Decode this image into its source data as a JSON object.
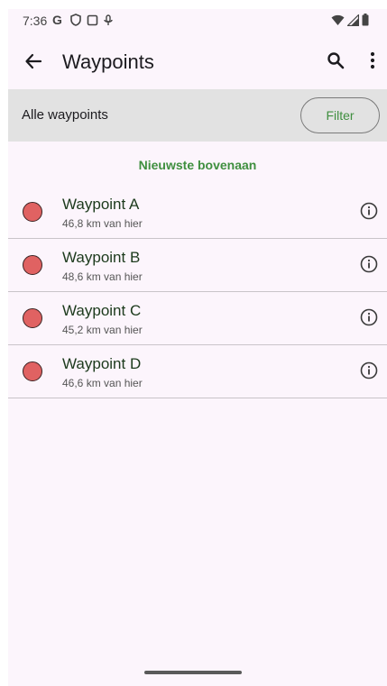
{
  "status_bar": {
    "time": "7:36",
    "icons_left": [
      "google-icon",
      "shield-icon",
      "screen-icon",
      "mic-icon"
    ],
    "icons_right": [
      "wifi-icon",
      "signal-icon",
      "battery-icon"
    ]
  },
  "app_bar": {
    "title": "Waypoints",
    "back_icon": "arrow-back-icon",
    "search_icon": "search-icon",
    "more_icon": "more-vert-icon"
  },
  "filter_bar": {
    "label": "Alle waypoints",
    "button_label": "Filter"
  },
  "sort_label": "Nieuwste bovenaan",
  "waypoints": [
    {
      "name": "Waypoint A",
      "distance": "46,8 km van hier"
    },
    {
      "name": "Waypoint B",
      "distance": "48,6 km van hier"
    },
    {
      "name": "Waypoint C",
      "distance": "45,2 km van hier"
    },
    {
      "name": "Waypoint D",
      "distance": "46,6 km van hier"
    }
  ],
  "colors": {
    "accent_green": "#3f8f3f",
    "waypoint_dot": "#e06262",
    "background": "#fcf5fc",
    "filter_bar_bg": "#e2e2e2"
  }
}
